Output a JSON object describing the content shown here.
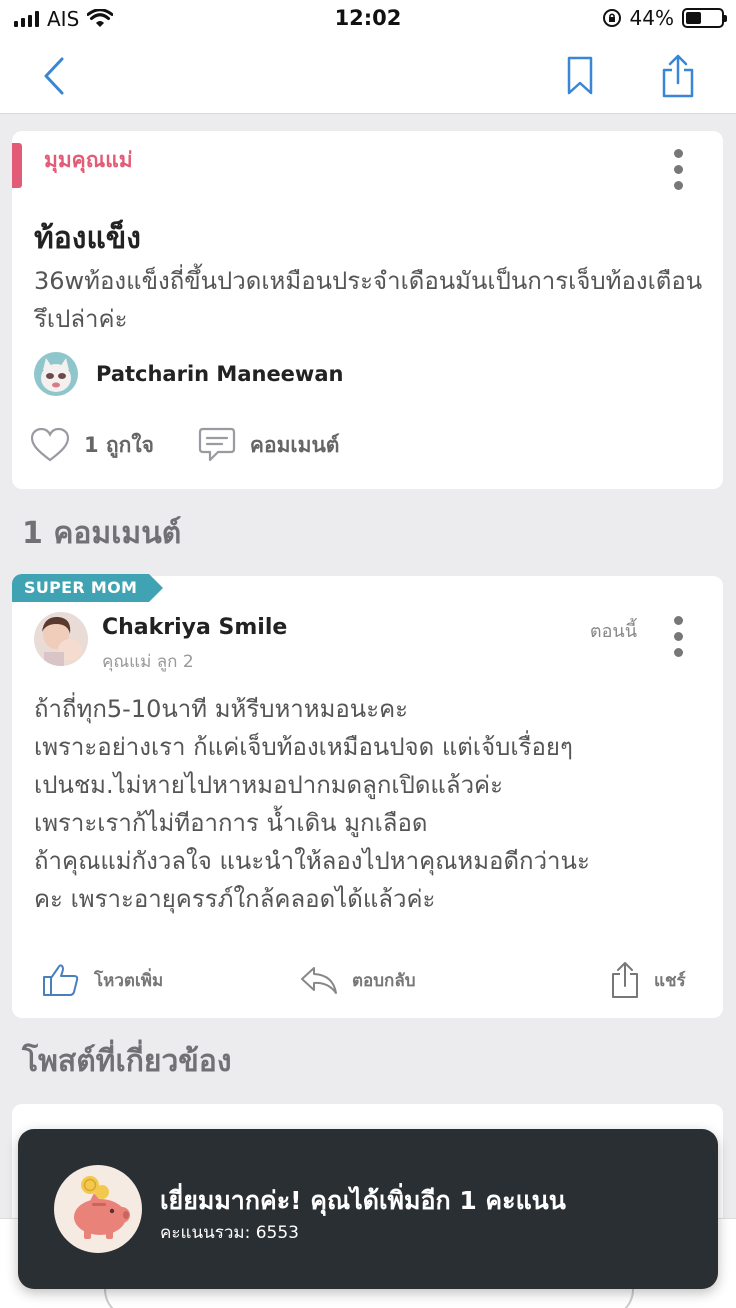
{
  "status_bar": {
    "carrier": "AIS",
    "time": "12:02",
    "battery_percent": "44%",
    "battery_level": 0.44
  },
  "nav": {
    "icons": [
      "chevron-left-icon",
      "bookmark-icon",
      "share-icon"
    ]
  },
  "post": {
    "category": "มุมคุณแม่",
    "title": "ท้องแข็ง",
    "body": "36wท้องแข็งถี่ขึ้นปวดเหมือนประจำเดือนมันเป็นการเจ็บท้องเตือนรึเปล่าค่ะ",
    "author": "Patcharin Maneewan",
    "like_label": "1 ถูกใจ",
    "comment_label": "คอมเมนต์"
  },
  "comments_section": {
    "title": "1 คอมเมนต์"
  },
  "comment": {
    "badge": "SUPER MOM",
    "author": "Chakriya Smile",
    "subtitle": "คุณแม่ ลูก 2",
    "time": "ตอนนี้",
    "lines": [
      "ถ้าถี่ทุก5-10นาที มห้รีบหาหมอนะคะ",
      "เพราะอย่างเรา ก้แค่เจ็บท้องเหมือนปจด แต่เจ้บเรื่อยๆ",
      "เปนชม.ไม่หายไปหาหมอปากมดลูกเปิดแล้วค่ะ",
      "เพราะเราก้ไม่ทีอาการ น้ำเดิน มูกเลือด",
      "ถ้าคุณแม่กังวลใจ แนะนำให้ลองไปหาคุณหมอดีกว่านะ",
      "คะ เพราะอายุครรภ์ใกล้คลอดได้แล้วค่ะ"
    ],
    "vote_label": "โหวตเพิ่ม",
    "reply_label": "ตอบกลับ",
    "share_label": "แชร์"
  },
  "related": {
    "title": "โพสต์ที่เกี่ยวข้อง"
  },
  "toast": {
    "title": "เยี่ยมมากค่ะ! คุณได้เพิ่มอีก 1 คะแนน",
    "subtitle": "คะแนนรวม: 6553",
    "icon": "piggy-bank-coin-icon"
  },
  "colors": {
    "accent_blue": "#3a86d6",
    "category_pink": "#e35c77",
    "badge_teal": "#3fa3b3",
    "toast_bg": "#2a2f33"
  }
}
